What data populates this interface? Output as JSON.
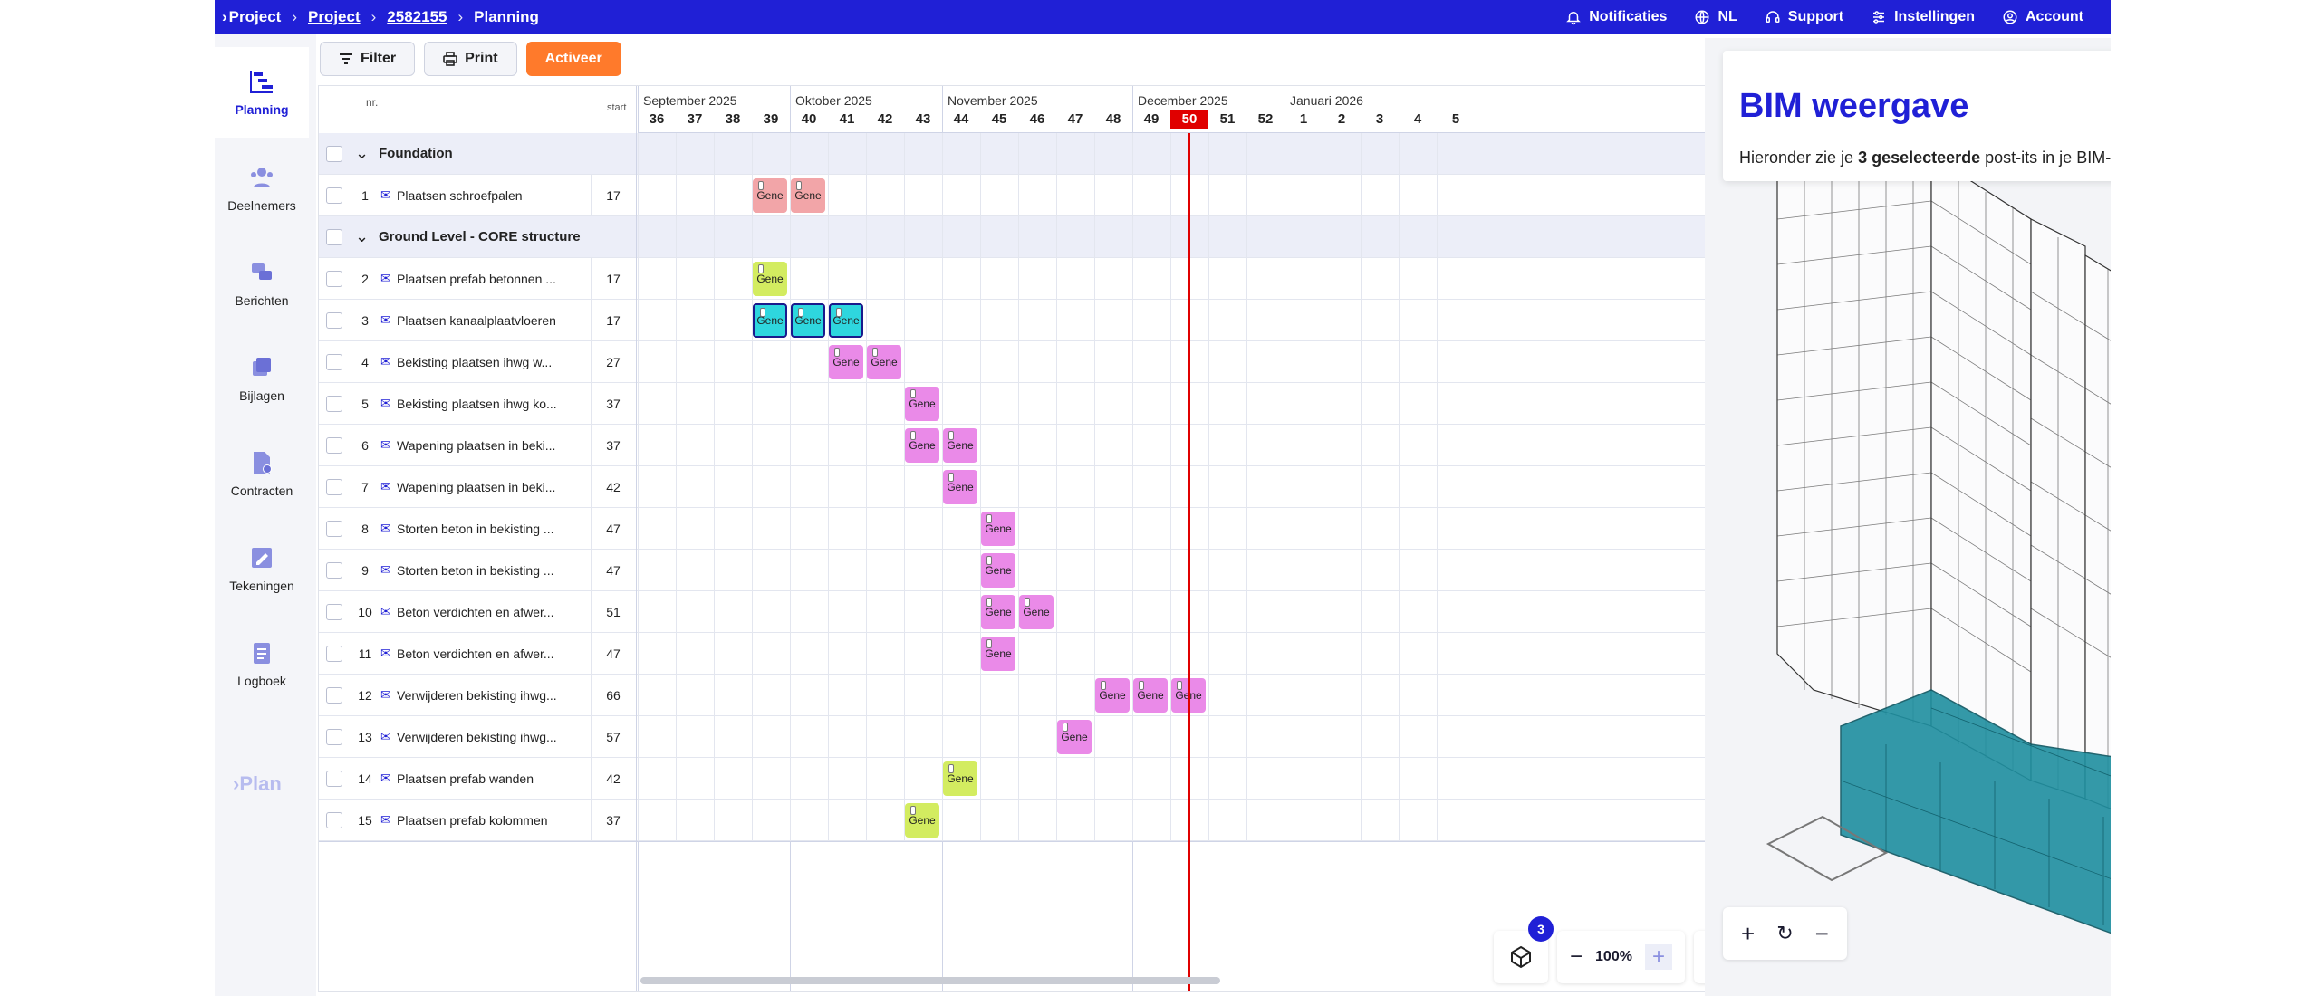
{
  "topbar": {
    "brand": "Project",
    "breadcrumbs": [
      "Project",
      "2582155",
      "Planning"
    ],
    "nav": [
      {
        "label": "Notificaties",
        "icon": "bell-icon"
      },
      {
        "label": "NL",
        "icon": "globe-icon"
      },
      {
        "label": "Support",
        "icon": "headset-icon"
      },
      {
        "label": "Instellingen",
        "icon": "sliders-icon"
      },
      {
        "label": "Account",
        "icon": "user-icon"
      }
    ]
  },
  "sidebar": {
    "items": [
      {
        "label": "Planning",
        "icon": "planning-icon",
        "active": true
      },
      {
        "label": "Deelnemers",
        "icon": "participants-icon"
      },
      {
        "label": "Berichten",
        "icon": "messages-icon"
      },
      {
        "label": "Bijlagen",
        "icon": "attachments-icon"
      },
      {
        "label": "Contracten",
        "icon": "contracts-icon"
      },
      {
        "label": "Tekeningen",
        "icon": "drawings-icon"
      },
      {
        "label": "Logboek",
        "icon": "logbook-icon"
      }
    ],
    "logo": "Plan"
  },
  "toolbar": {
    "filter": "Filter",
    "print": "Print",
    "activate": "Activeer"
  },
  "grid": {
    "header": {
      "nr": "nr.",
      "start": "start"
    },
    "months": [
      {
        "label": "September 2025"
      },
      {
        "label": "Oktober 2025"
      },
      {
        "label": "November 2025"
      },
      {
        "label": "December 2025"
      },
      {
        "label": "Januari 2026"
      }
    ],
    "weeks": [
      "36",
      "37",
      "38",
      "39",
      "40",
      "41",
      "42",
      "43",
      "44",
      "45",
      "46",
      "47",
      "48",
      "49",
      "50",
      "51",
      "52",
      "1",
      "2",
      "3",
      "4",
      "5"
    ],
    "current_week": "50",
    "bar_label": "Gene",
    "groups": [
      {
        "name": "Foundation"
      },
      {
        "name": "Ground Level - CORE structure"
      }
    ],
    "tasks": [
      {
        "nr": "1",
        "name": "Plaatsen schroefpalen",
        "start": "17"
      },
      {
        "nr": "2",
        "name": "Plaatsen prefab betonnen ...",
        "start": "17"
      },
      {
        "nr": "3",
        "name": "Plaatsen kanaalplaatvloeren",
        "start": "17"
      },
      {
        "nr": "4",
        "name": "Bekisting plaatsen ihwg w...",
        "start": "27"
      },
      {
        "nr": "5",
        "name": "Bekisting plaatsen ihwg ko...",
        "start": "37"
      },
      {
        "nr": "6",
        "name": "Wapening plaatsen in beki...",
        "start": "37"
      },
      {
        "nr": "7",
        "name": "Wapening plaatsen in beki...",
        "start": "42"
      },
      {
        "nr": "8",
        "name": "Storten beton in bekisting ...",
        "start": "47"
      },
      {
        "nr": "9",
        "name": "Storten beton in bekisting ...",
        "start": "47"
      },
      {
        "nr": "10",
        "name": "Beton verdichten en afwer...",
        "start": "51"
      },
      {
        "nr": "11",
        "name": "Beton verdichten en afwer...",
        "start": "47"
      },
      {
        "nr": "12",
        "name": "Verwijderen bekisting ihwg...",
        "start": "66"
      },
      {
        "nr": "13",
        "name": "Verwijderen bekisting ihwg...",
        "start": "57"
      },
      {
        "nr": "14",
        "name": "Plaatsen prefab wanden",
        "start": "42"
      },
      {
        "nr": "15",
        "name": "Plaatsen prefab kolommen",
        "start": "37"
      }
    ],
    "bars": [
      {
        "row": 1,
        "weeks": [
          "39",
          "40"
        ],
        "color": "#f2a5a8"
      },
      {
        "row": 2,
        "weeks": [
          "39"
        ],
        "color": "#d3ec60"
      },
      {
        "row": 3,
        "weeks": [
          "39",
          "40",
          "41"
        ],
        "color": "#2ed6de",
        "selected": true
      },
      {
        "row": 4,
        "weeks": [
          "41",
          "42"
        ],
        "color": "#ea8ae8"
      },
      {
        "row": 5,
        "weeks": [
          "43"
        ],
        "color": "#ea8ae8"
      },
      {
        "row": 6,
        "weeks": [
          "43",
          "44"
        ],
        "color": "#ea8ae8"
      },
      {
        "row": 7,
        "weeks": [
          "44"
        ],
        "color": "#ea8ae8"
      },
      {
        "row": 8,
        "weeks": [
          "45"
        ],
        "color": "#ea8ae8"
      },
      {
        "row": 9,
        "weeks": [
          "45"
        ],
        "color": "#ea8ae8"
      },
      {
        "row": 10,
        "weeks": [
          "45",
          "46"
        ],
        "color": "#ea8ae8"
      },
      {
        "row": 11,
        "weeks": [
          "45"
        ],
        "color": "#ea8ae8"
      },
      {
        "row": 12,
        "weeks": [
          "48",
          "49",
          "50"
        ],
        "color": "#ea8ae8"
      },
      {
        "row": 13,
        "weeks": [
          "47"
        ],
        "color": "#ea8ae8"
      },
      {
        "row": 14,
        "weeks": [
          "44"
        ],
        "color": "#d3ec60"
      },
      {
        "row": 15,
        "weeks": [
          "43"
        ],
        "color": "#d3ec60"
      }
    ]
  },
  "zoom": {
    "badge": "3",
    "level": "100%",
    "scale": "Week"
  },
  "bim": {
    "title": "BIM weergave",
    "subtitle_pre": "Hieronder zie je ",
    "subtitle_bold": "3 geselecteerde",
    "subtitle_post": " post-its in je BIM-model.",
    "accent": "#2020d6",
    "highlight": "#1f8fa0"
  }
}
